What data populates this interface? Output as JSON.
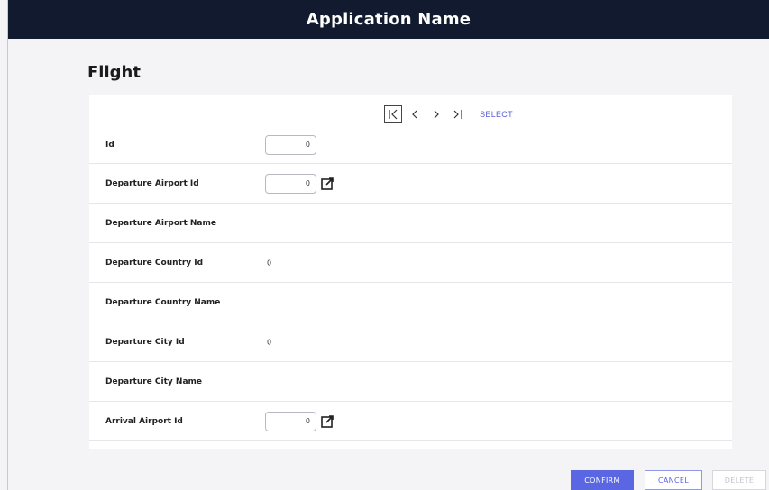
{
  "app": {
    "title": "Application Name"
  },
  "page": {
    "title": "Flight"
  },
  "navigation": {
    "first_icon": "first-record-icon",
    "previous_icon": "previous-icon",
    "next_icon": "next-icon",
    "last_icon": "last-record-icon",
    "select_label": "SELECT"
  },
  "fields": [
    {
      "label": "Id",
      "value": "0",
      "type": "input"
    },
    {
      "label": "Departure Airport Id",
      "value": "0",
      "type": "input",
      "icon": "edit-link-icon"
    },
    {
      "label": "Departure Airport Name",
      "value": "",
      "type": "text"
    },
    {
      "label": "Departure Country Id",
      "value": "0",
      "type": "text"
    },
    {
      "label": "Departure Country Name",
      "value": "",
      "type": "text"
    },
    {
      "label": "Departure City Id",
      "value": "0",
      "type": "text"
    },
    {
      "label": "Departure City Name",
      "value": "",
      "type": "text"
    },
    {
      "label": "Arrival Airport Id",
      "value": "0",
      "type": "input",
      "icon": "edit-link-icon"
    }
  ],
  "footer": {
    "confirm_label": "CONFIRM",
    "cancel_label": "CANCEL",
    "delete_label": "DELETE"
  },
  "colors": {
    "header_bg": "#111a2e",
    "accent": "#5b66e3"
  }
}
